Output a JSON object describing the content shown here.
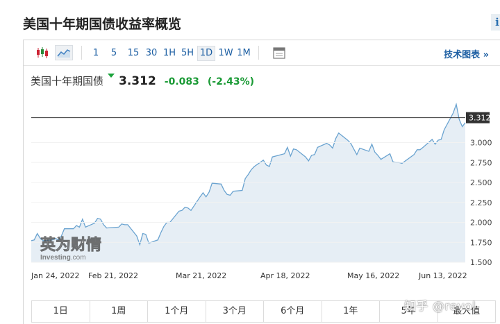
{
  "page": {
    "title": "美国十年期国债收益率概览",
    "info_icon": "i"
  },
  "toolbar": {
    "icons": [
      "candlestick-icon",
      "area-chart-icon",
      "calendar-icon"
    ],
    "timeframes": [
      "1",
      "5",
      "15",
      "30",
      "1H",
      "5H",
      "1D",
      "1W",
      "1M"
    ],
    "active_timeframe": "1D",
    "tech_chart_link": "技术图表 »"
  },
  "quote": {
    "name": "美国十年期国债",
    "price": "3.312",
    "change": "-0.083",
    "change_pct": "(-2.43%)",
    "direction": "down",
    "color_down": "#1a9a35"
  },
  "watermark": {
    "brand_cn": "英为财情",
    "brand_en": "Investing",
    "brand_suffix": ".com"
  },
  "range_buttons": [
    "1日",
    "1周",
    "1个月",
    "3个月",
    "6个月",
    "1年",
    "5年",
    "最大值"
  ],
  "footer_watermark": "知乎 @revol",
  "chart_data": {
    "type": "area",
    "title": "",
    "xlabel": "",
    "ylabel": "",
    "x_ticks": [
      "Jan 24, 2022",
      "Feb 21, 2022",
      "Mar 21, 2022",
      "Apr 18, 2022",
      "May 16, 2022",
      "Jun 13, 2022"
    ],
    "y_ticks": [
      "1.500",
      "1.750",
      "2.000",
      "2.250",
      "2.500",
      "2.750",
      "3.000"
    ],
    "ylim": [
      1.5,
      3.3
    ],
    "current_value": 3.312,
    "current_label": "3.312",
    "line_color": "#6aa3d0",
    "fill_color": "#e6eef5",
    "x": [
      "2022-01-24",
      "2022-01-25",
      "2022-01-26",
      "2022-01-27",
      "2022-01-28",
      "2022-01-31",
      "2022-02-01",
      "2022-02-02",
      "2022-02-03",
      "2022-02-04",
      "2022-02-07",
      "2022-02-08",
      "2022-02-09",
      "2022-02-10",
      "2022-02-11",
      "2022-02-14",
      "2022-02-15",
      "2022-02-16",
      "2022-02-17",
      "2022-02-18",
      "2022-02-22",
      "2022-02-23",
      "2022-02-24",
      "2022-02-25",
      "2022-02-28",
      "2022-03-01",
      "2022-03-02",
      "2022-03-03",
      "2022-03-04",
      "2022-03-07",
      "2022-03-08",
      "2022-03-09",
      "2022-03-10",
      "2022-03-11",
      "2022-03-14",
      "2022-03-15",
      "2022-03-16",
      "2022-03-17",
      "2022-03-18",
      "2022-03-21",
      "2022-03-22",
      "2022-03-23",
      "2022-03-24",
      "2022-03-25",
      "2022-03-28",
      "2022-03-29",
      "2022-03-30",
      "2022-03-31",
      "2022-04-01",
      "2022-04-04",
      "2022-04-05",
      "2022-04-06",
      "2022-04-07",
      "2022-04-08",
      "2022-04-11",
      "2022-04-12",
      "2022-04-13",
      "2022-04-14",
      "2022-04-18",
      "2022-04-19",
      "2022-04-20",
      "2022-04-21",
      "2022-04-22",
      "2022-04-25",
      "2022-04-26",
      "2022-04-27",
      "2022-04-28",
      "2022-04-29",
      "2022-05-02",
      "2022-05-03",
      "2022-05-04",
      "2022-05-05",
      "2022-05-06",
      "2022-05-09",
      "2022-05-10",
      "2022-05-11",
      "2022-05-12",
      "2022-05-13",
      "2022-05-16",
      "2022-05-17",
      "2022-05-18",
      "2022-05-19",
      "2022-05-20",
      "2022-05-23",
      "2022-05-24",
      "2022-05-25",
      "2022-05-26",
      "2022-05-27",
      "2022-05-31",
      "2022-06-01",
      "2022-06-02",
      "2022-06-03",
      "2022-06-06",
      "2022-06-07",
      "2022-06-08",
      "2022-06-09",
      "2022-06-10",
      "2022-06-13",
      "2022-06-14",
      "2022-06-15",
      "2022-06-16",
      "2022-06-17"
    ],
    "values": [
      1.77,
      1.78,
      1.86,
      1.8,
      1.77,
      1.78,
      1.8,
      1.78,
      1.83,
      1.92,
      1.92,
      1.96,
      1.94,
      2.04,
      1.94,
      1.99,
      2.05,
      2.04,
      1.97,
      1.93,
      1.94,
      1.98,
      1.97,
      1.97,
      1.83,
      1.72,
      1.86,
      1.85,
      1.74,
      1.78,
      1.87,
      1.95,
      2.0,
      2.0,
      2.14,
      2.15,
      2.19,
      2.18,
      2.15,
      2.32,
      2.37,
      2.32,
      2.38,
      2.49,
      2.48,
      2.4,
      2.35,
      2.34,
      2.39,
      2.4,
      2.55,
      2.6,
      2.66,
      2.7,
      2.78,
      2.72,
      2.7,
      2.82,
      2.86,
      2.94,
      2.83,
      2.92,
      2.91,
      2.82,
      2.77,
      2.84,
      2.85,
      2.94,
      2.99,
      2.97,
      2.93,
      3.05,
      3.12,
      3.03,
      2.99,
      2.92,
      2.85,
      2.93,
      2.89,
      2.98,
      2.88,
      2.84,
      2.79,
      2.86,
      2.76,
      2.75,
      2.75,
      2.74,
      2.85,
      2.91,
      2.91,
      2.94,
      3.04,
      2.98,
      3.03,
      3.04,
      3.16,
      3.37,
      3.48,
      3.29,
      3.2,
      3.25
    ]
  }
}
